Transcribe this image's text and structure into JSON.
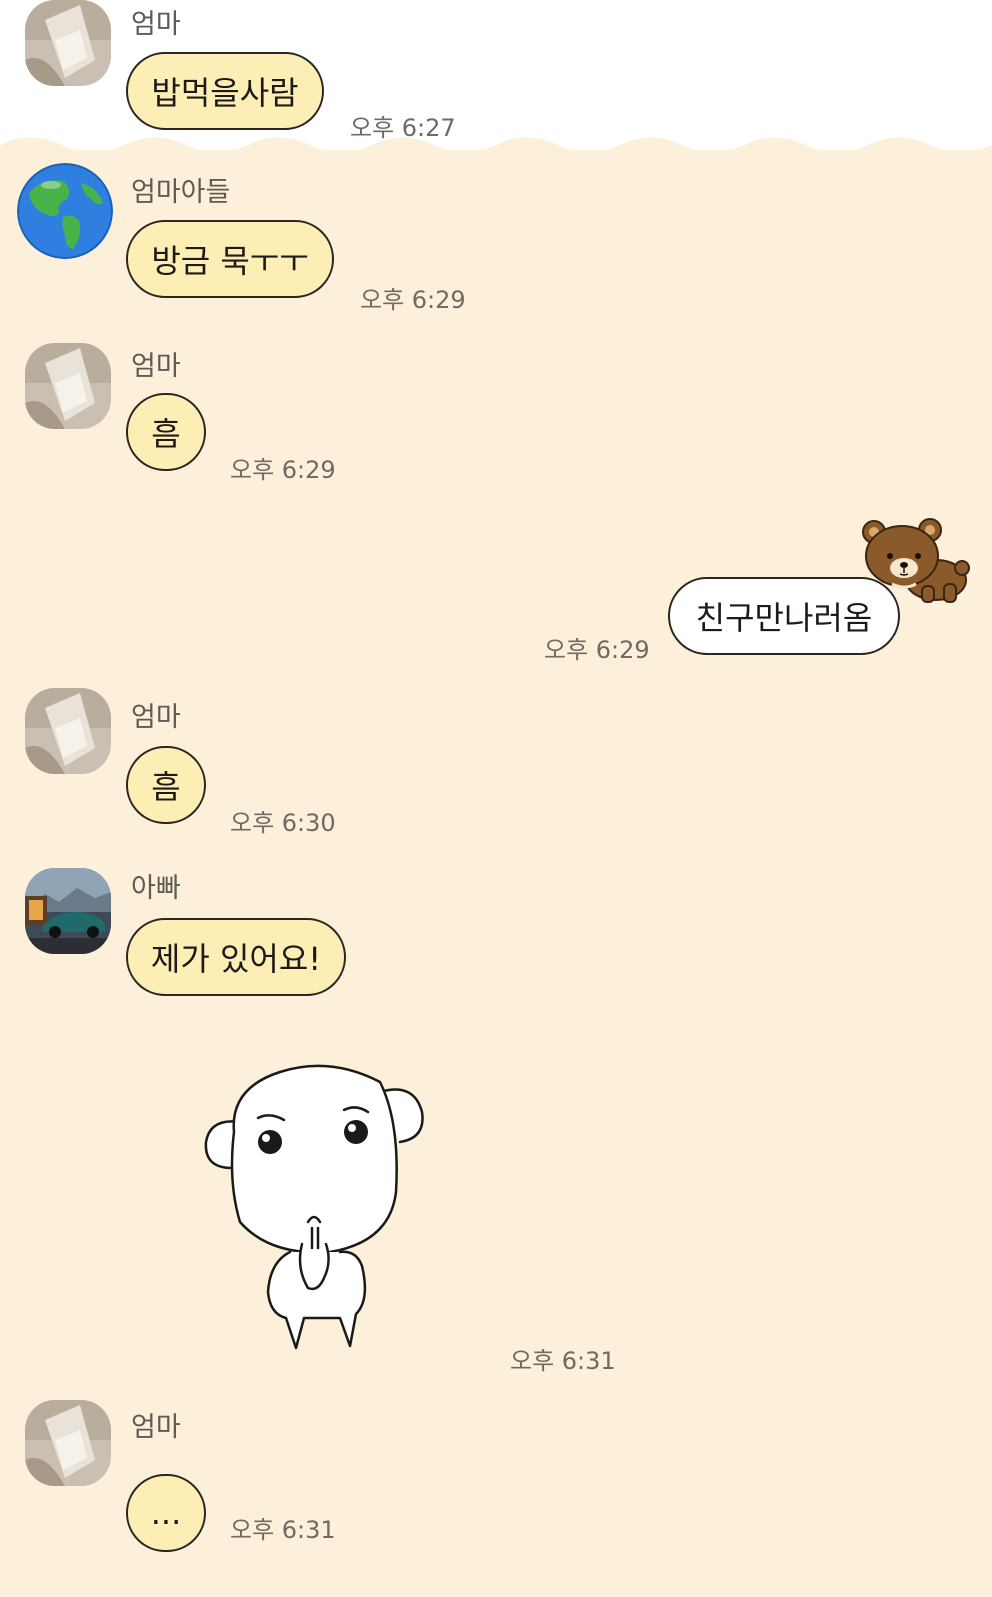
{
  "messages": [
    {
      "sender": "엄마",
      "text": "밥먹을사람",
      "time": "오후 6:27",
      "avatar": "mom-avatar"
    },
    {
      "sender": "엄마아들",
      "text": "방금 묵ㅜㅜ",
      "time": "오후 6:29",
      "avatar": "earth-globe-avatar"
    },
    {
      "sender": "엄마",
      "text": "흠",
      "time": "오후 6:29",
      "avatar": "mom-avatar"
    },
    {
      "sender": "me",
      "text": "친구만나러옴",
      "time": "오후 6:29",
      "decoration": "bear-sticker-icon"
    },
    {
      "sender": "엄마",
      "text": "흠",
      "time": "오후 6:30",
      "avatar": "mom-avatar"
    },
    {
      "sender": "아빠",
      "text": "제가 있어요!",
      "time": "",
      "avatar": "car-photo-avatar"
    },
    {
      "sender": "아빠",
      "sticker": "praying-dog-sticker",
      "time": "오후 6:31"
    },
    {
      "sender": "엄마",
      "text": "...",
      "time": "오후 6:31",
      "avatar": "mom-avatar"
    }
  ],
  "colors": {
    "background": "#fcf0da",
    "incoming_bubble": "#fdeeb5",
    "outgoing_bubble": "#ffffff",
    "bubble_border": "#2b2622"
  }
}
